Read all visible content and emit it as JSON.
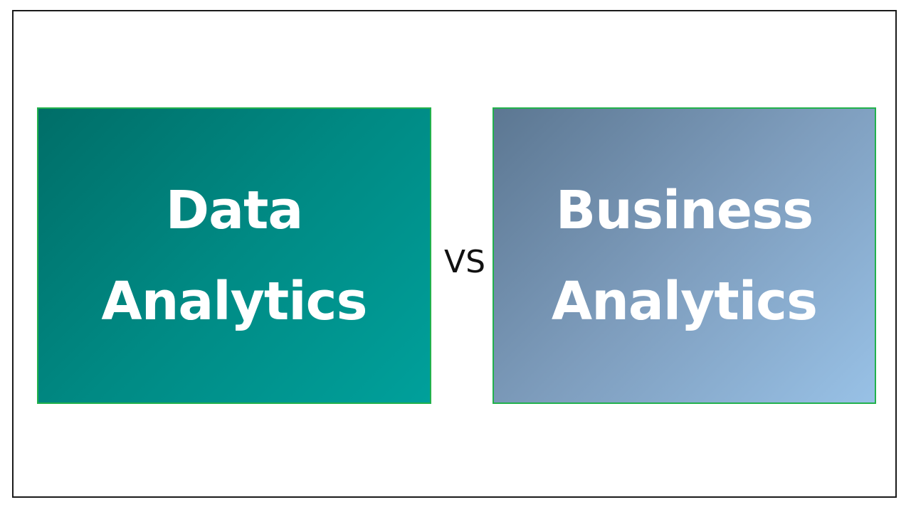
{
  "left_box": {
    "line1": "Data",
    "line2": "Analytics",
    "color": "#008a84"
  },
  "separator": "VS",
  "right_box": {
    "line1": "Business",
    "line2": "Analytics",
    "color": "#7e9dbd"
  },
  "border_color": "#22b14c"
}
